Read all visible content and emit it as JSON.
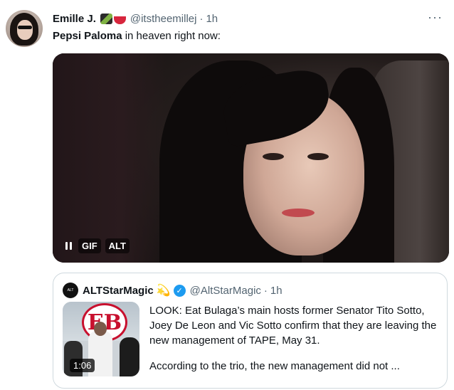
{
  "tweet": {
    "author_name": "Emille J.",
    "emoji": [
      "clapperboard-emoji",
      "lipstick-emoji"
    ],
    "handle": "@itstheemillej",
    "separator": "·",
    "time": "1h",
    "more": "···",
    "text_mention": "Pepsi Paloma",
    "text_rest": " in heaven right now:"
  },
  "media": {
    "badge_gif": "GIF",
    "badge_alt": "ALT"
  },
  "quote": {
    "avatar_text": "ALT",
    "author_name": "ALTStarMagic",
    "star": "💫",
    "verified": "✓",
    "handle": "@AltStarMagic",
    "separator": "·",
    "time": "1h",
    "thumbnail_logo": "EB",
    "duration": "1:06",
    "paragraph1": "LOOK: Eat Bulaga’s main hosts former Senator Tito Sotto, Joey De Leon and Vic Sotto confirm that they are leaving the new management of TAPE, May 31.",
    "paragraph2": "According to the trio, the new management did not ..."
  }
}
